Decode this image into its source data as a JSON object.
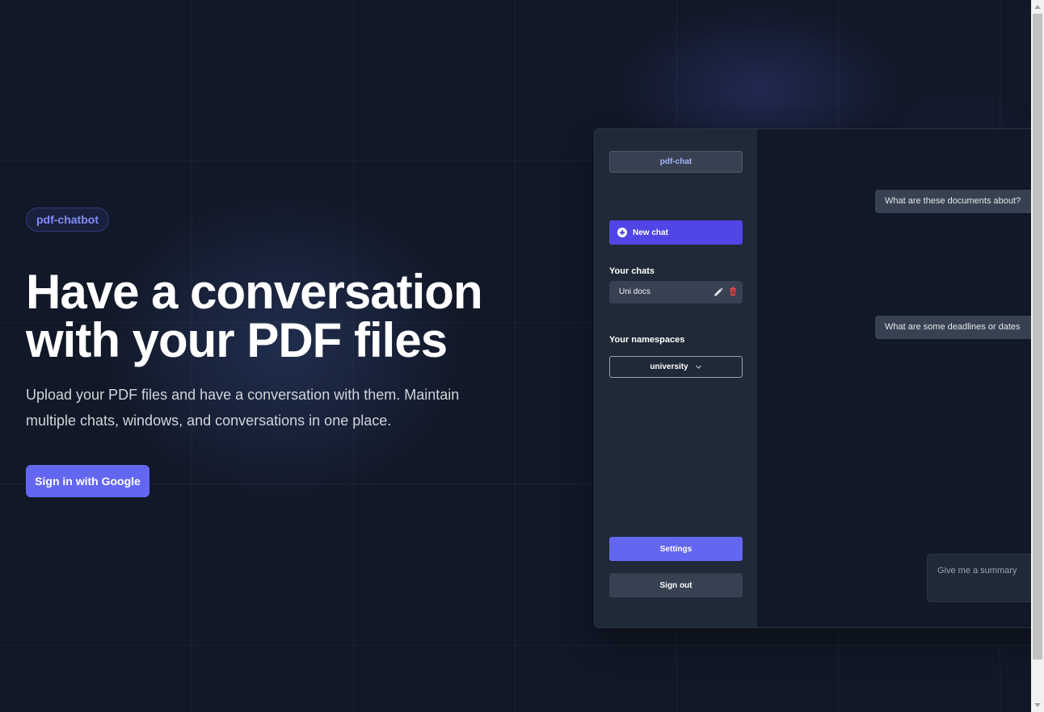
{
  "hero": {
    "badge": "pdf-chatbot",
    "title_line1": "Have a conversation",
    "title_line2": "with your PDF files",
    "subtitle": "Upload your PDF files and have a conversation with them. Maintain multiple chats, windows, and conversations in one place.",
    "cta_label": "Sign in with Google"
  },
  "preview": {
    "app_name": "pdf-chat",
    "new_chat_label": "New chat",
    "chats_heading": "Your chats",
    "chats": [
      {
        "label": "Uni docs"
      }
    ],
    "namespaces_heading": "Your namespaces",
    "namespace_selected": "university",
    "settings_label": "Settings",
    "signout_label": "Sign out",
    "messages": [
      {
        "text": "What are these documents about?"
      },
      {
        "text": "What are some deadlines or dates"
      }
    ],
    "input_placeholder": "Give me a summary"
  },
  "colors": {
    "background": "#111827",
    "accent": "#6366f1",
    "accent_dark": "#4f46e5",
    "badge_text": "#818cf8",
    "delete": "#ef4444"
  },
  "icons": {
    "new_chat": "plus-circle-icon",
    "edit": "pencil-icon",
    "delete": "trash-icon",
    "dropdown": "chevron-down-icon"
  }
}
